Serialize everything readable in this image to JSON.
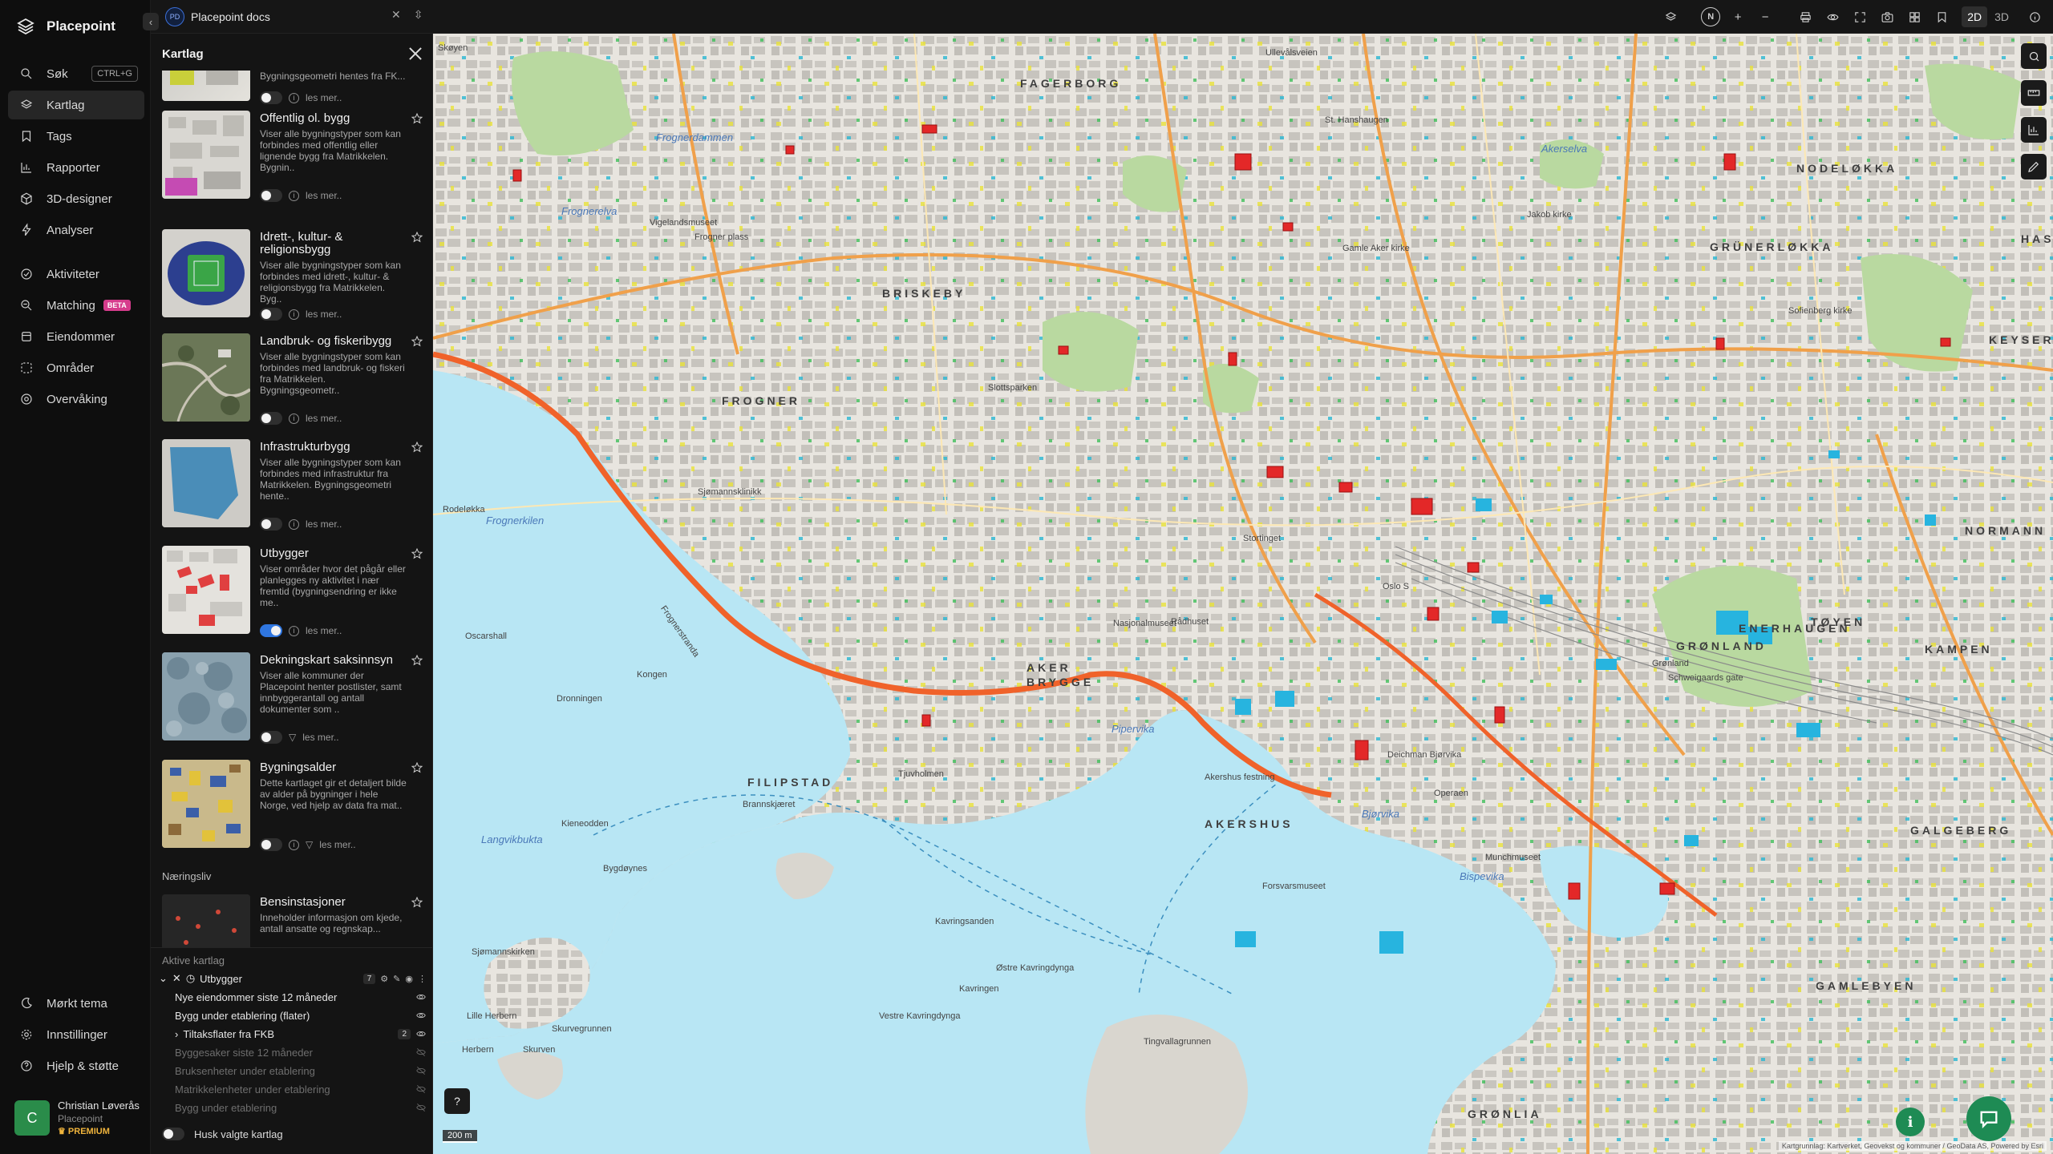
{
  "app": {
    "name": "Placepoint"
  },
  "nav": {
    "items": [
      {
        "label": "Søk",
        "icon": "search-icon",
        "shortcut": "CTRL+G"
      },
      {
        "label": "Kartlag",
        "icon": "layers-icon",
        "active": true
      },
      {
        "label": "Tags",
        "icon": "bookmark-icon"
      },
      {
        "label": "Rapporter",
        "icon": "chart-icon"
      },
      {
        "label": "3D-designer",
        "icon": "cube-icon"
      },
      {
        "label": "Analyser",
        "icon": "bolt-icon"
      }
    ],
    "items2": [
      {
        "label": "Aktiviteter",
        "icon": "activity-icon"
      },
      {
        "label": "Matching",
        "icon": "matching-icon",
        "badge": "BETA"
      },
      {
        "label": "Eiendommer",
        "icon": "property-icon"
      },
      {
        "label": "Områder",
        "icon": "area-icon"
      },
      {
        "label": "Overvåking",
        "icon": "monitor-icon"
      }
    ],
    "bottom": [
      {
        "label": "Mørkt tema",
        "icon": "moon-icon"
      },
      {
        "label": "Innstillinger",
        "icon": "gear-icon"
      },
      {
        "label": "Hjelp & støtte",
        "icon": "help-icon"
      }
    ],
    "user": {
      "initial": "C",
      "name": "Christian Løverås",
      "org": "Placepoint",
      "plan": "PREMIUM"
    }
  },
  "topbar": {
    "doc_badge": "PD",
    "doc_name": "Placepoint docs",
    "north": "N",
    "view_2d": "2D",
    "view_3d": "3D"
  },
  "panel": {
    "title": "Kartlag",
    "read_more": "les mer..",
    "partial_top": {
      "desc": "Bygningsgeometri hentes fra FK..."
    },
    "layers": [
      {
        "title": "Offentlig ol. bygg",
        "desc": "Viser alle bygningstyper som kan forbindes med offentlig eller lignende bygg fra Matrikkelen. Bygnin..",
        "on": false
      },
      {
        "title": "Idrett-, kultur- & religionsbygg",
        "desc": "Viser alle bygningstyper som kan forbindes med idrett-, kultur- & religionsbygg fra Matrikkelen. Byg..",
        "on": false
      },
      {
        "title": "Landbruk- og fiskeribygg",
        "desc": "Viser alle bygningstyper som kan forbindes med landbruk- og fiskeri fra Matrikkelen. Bygningsgeometr..",
        "on": false
      },
      {
        "title": "Infrastrukturbygg",
        "desc": "Viser alle bygningstyper som kan forbindes med infrastruktur fra Matrikkelen. Bygningsgeometri hente..",
        "on": false
      },
      {
        "title": "Utbygger",
        "desc": "Viser områder hvor det pågår eller planlegges ny aktivitet i nær fremtid (bygningsendring er ikke me..",
        "on": true
      },
      {
        "title": "Dekningskart saksinnsyn",
        "desc": "Viser alle kommuner der Placepoint henter postlister, samt innbyggerantall og antall dokumenter som ..",
        "on": false
      },
      {
        "title": "Bygningsalder",
        "desc": "Dette kartlaget gir et detaljert bilde av alder på bygninger i hele Norge, ved hjelp av data fra mat..",
        "on": false
      }
    ],
    "section_naeringsliv": "Næringsliv",
    "bensin": {
      "title": "Bensinstasjoner",
      "desc": "Inneholder informasjon om kjede, antall ansatte og regnskap..."
    },
    "active": {
      "heading": "Aktive kartlag",
      "group": "Utbygger",
      "group_count": "7",
      "rows": [
        {
          "label": "Nye eiendommer siste 12 måneder",
          "visible": true
        },
        {
          "label": "Bygg under etablering (flater)",
          "visible": true
        },
        {
          "label": "Tiltaksflater fra FKB",
          "visible": true,
          "count": "2",
          "expandable": true
        },
        {
          "label": "Byggesaker siste 12 måneder",
          "visible": false
        },
        {
          "label": "Bruksenheter under etablering",
          "visible": false
        },
        {
          "label": "Matrikkelenheter under etablering",
          "visible": false
        },
        {
          "label": "Bygg under etablering",
          "visible": false
        }
      ],
      "remember": "Husk valgte kartlag"
    }
  },
  "map": {
    "districts": [
      "FAGERBORG",
      "NODELØKKA",
      "GRÜNERLØKKA",
      "BRISKEBY",
      "FROGNER",
      "KEYSER",
      "AKER BRYGGE",
      "TØYEN",
      "NORMANN",
      "ENERHAUGEN",
      "GRØNLAND",
      "KAMPEN",
      "FILIPSTAD",
      "AKERSHUS",
      "GALGEBERG",
      "GAMLEBYEN",
      "GRØNLIA",
      "HAS"
    ],
    "water": [
      "Frognerkilen",
      "Frognerelva",
      "Akerselva",
      "Pipervika",
      "Bjørvika",
      "Langvikbukta",
      "Bispevika",
      "Frognerdammen"
    ],
    "places": [
      "Skøyen",
      "Vigelandsmuseet",
      "Frogner plass",
      "Oscarshall",
      "Frognerstranda",
      "Kongen",
      "Dronningen",
      "Rodeløkka",
      "Nasjonalmuseet",
      "Rådhuset",
      "Stortinget",
      "Oslo S",
      "Munchmuseet",
      "Operaen",
      "Kavringen",
      "Østre Kavringdynga",
      "Vestre Kavringdynga",
      "Tingvallagrunnen",
      "Lille Herbern",
      "Skurvegrunnen",
      "Herbern",
      "Skurven",
      "Bygdøynes",
      "Kieneodden",
      "Brannskjæret",
      "Tjuvholmen",
      "Sjømannskirken",
      "Kavringsanden",
      "Akershus festning",
      "Forsvarsmuseet",
      "Deichman Bjørvika",
      "Grønland",
      "Schweigaards gate",
      "Slottsparken",
      "St. Hanshaugen",
      "Ullevålsveien",
      "Sofienberg kirke",
      "Jakob kirke",
      "Gamle Aker kirke",
      "Sjømannsklinikk"
    ],
    "scale": "200 m",
    "attribution": "Kartgrunnlag: Kartverket, Geovekst og kommuner / GeoData AS, Powered by Esri"
  },
  "colors": {
    "accent": "#2f76e0",
    "green": "#1e8b54",
    "beta": "#d63c8c",
    "premium": "#f0b43c"
  }
}
